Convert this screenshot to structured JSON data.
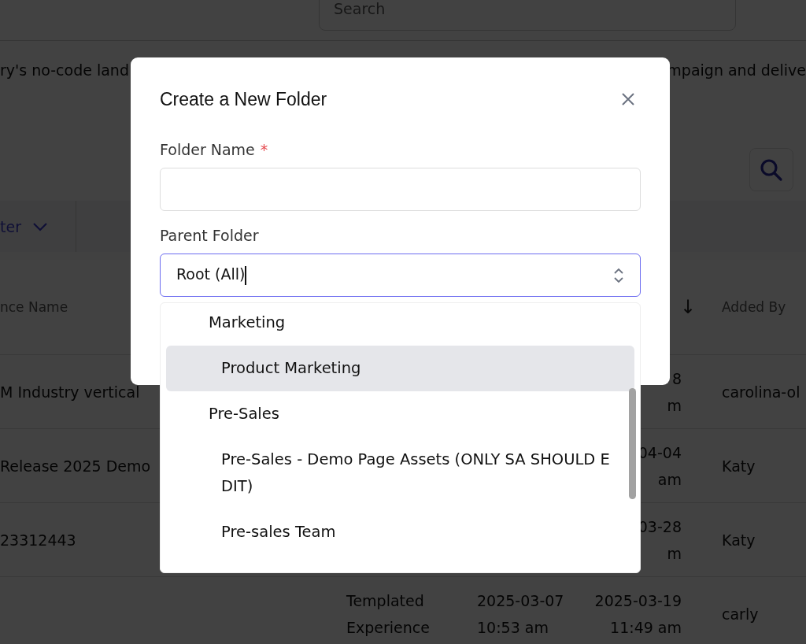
{
  "header": {
    "search": {
      "placeholder": "Search"
    }
  },
  "intro": {
    "left": "ry's no-code land",
    "right": "mpaign and delive"
  },
  "toolbar": {
    "filter_label": "ter"
  },
  "table": {
    "header": {
      "name": "nce Name",
      "sort_arrow": "↓",
      "added_by": "Added By"
    },
    "rows": [
      {
        "name": "M Industry vertical",
        "updated": [
          "8",
          "m"
        ],
        "added_by": "carolina-ol"
      },
      {
        "name": "Release 2025 Demo",
        "updated": [
          "04-04",
          "am"
        ],
        "added_by": "Katy"
      },
      {
        "name": "23312443",
        "updated": [
          "03-28",
          "m"
        ],
        "added_by": "Katy"
      },
      {
        "type": [
          "Templated",
          "Experience"
        ],
        "created": [
          "2025-03-07",
          "10:53 am"
        ],
        "updated": [
          "2025-03-19",
          "11:49 am"
        ],
        "added_by": "carly"
      }
    ]
  },
  "modal": {
    "title": "Create a New Folder",
    "folder_name": {
      "label": "Folder Name",
      "required": true,
      "required_mark": "*"
    },
    "parent_folder": {
      "label": "Parent Folder",
      "value": "Root (All)",
      "focused": true
    },
    "options": [
      {
        "label": "Marketing",
        "selected": false,
        "children": [
          {
            "label": "Product Marketing",
            "selected": true
          }
        ]
      },
      {
        "label": "Pre-Sales",
        "selected": false,
        "children": [
          {
            "label": "Pre-Sales - Demo Page Assets (ONLY SA SHOULD EDIT)",
            "selected": false
          },
          {
            "label": "Pre-sales Team",
            "selected": false
          }
        ]
      }
    ]
  }
}
